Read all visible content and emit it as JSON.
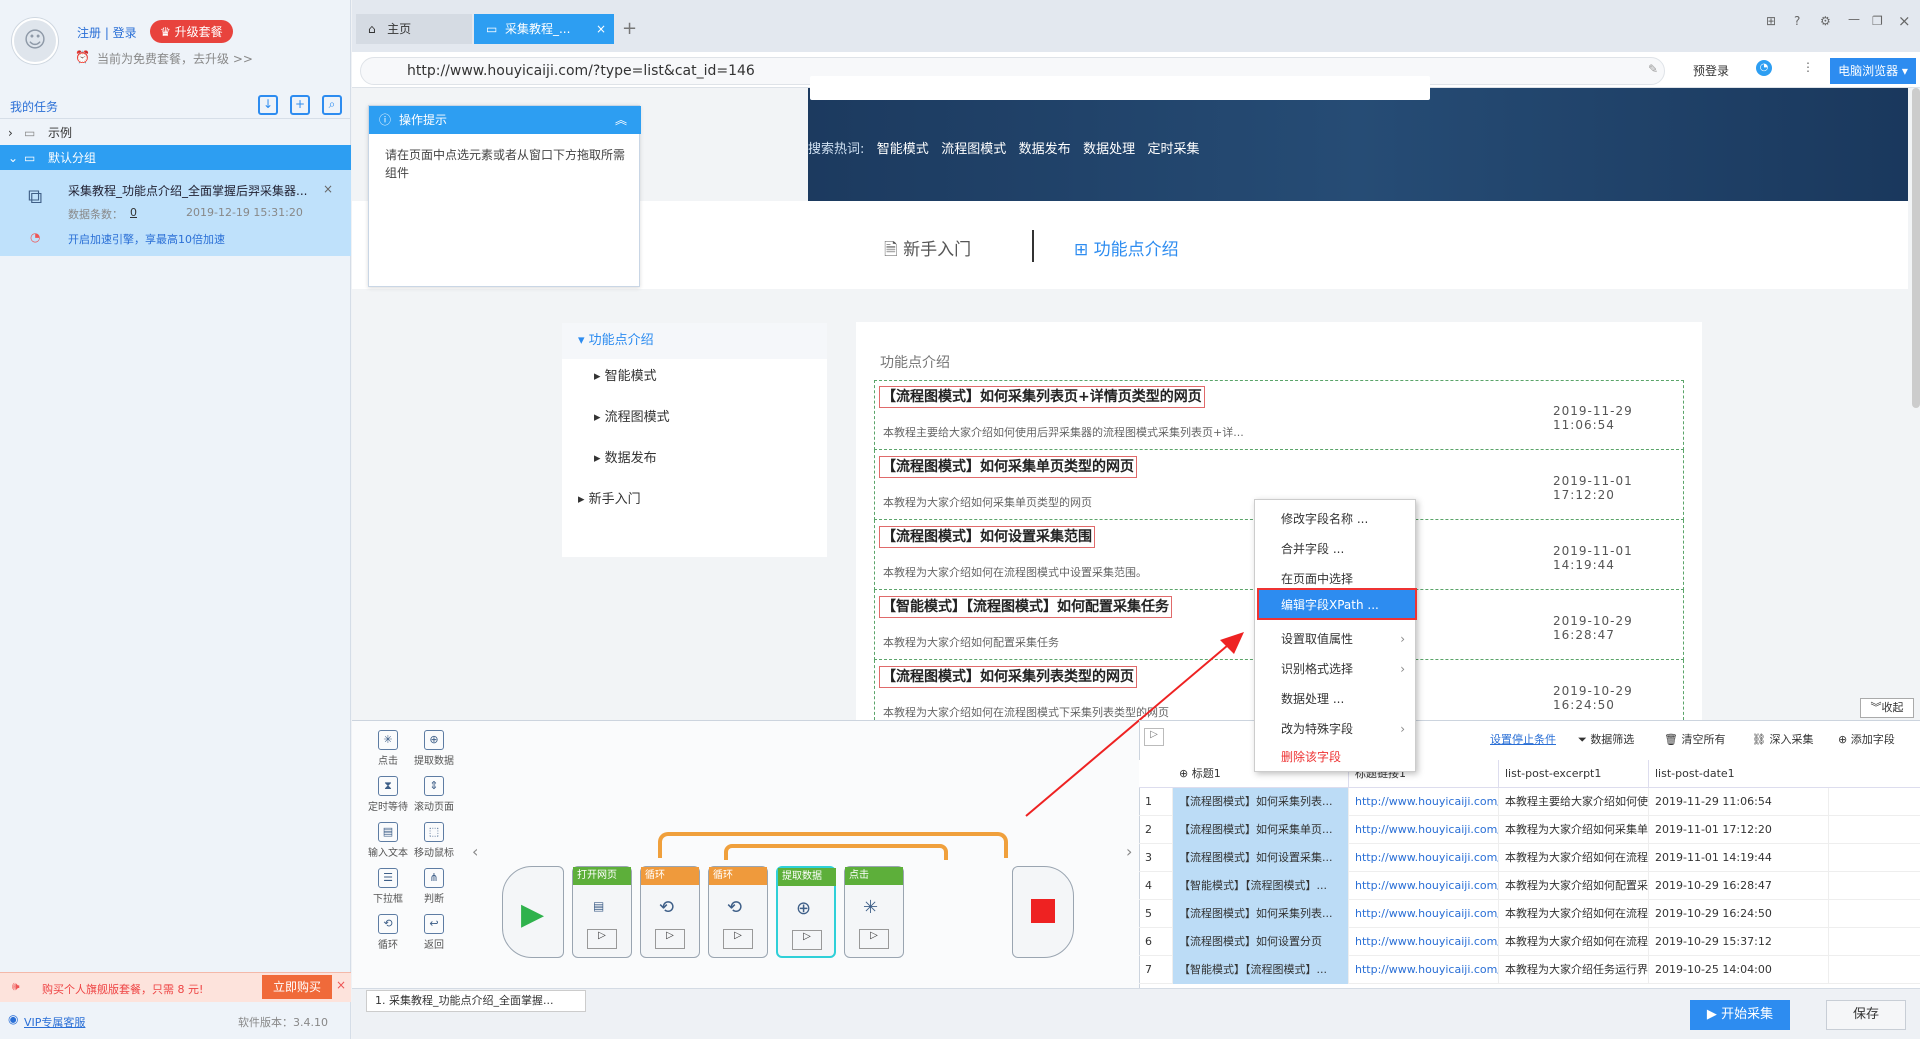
{
  "sidebar": {
    "register_login": "注册 | 登录",
    "upgrade": "升级套餐",
    "plan_text": "当前为免费套餐，去升级 >>",
    "my_tasks": "我的任务",
    "tree": [
      {
        "label": "示例"
      },
      {
        "label": "默认分组"
      }
    ],
    "task": {
      "title": "采集教程_功能点介绍_全面掌握后羿采集器...",
      "count_label": "数据条数：",
      "count": "0",
      "time": "2019-12-19 15:31:20",
      "boost": "开启加速引擎，享最高10倍加速"
    },
    "promo": "购买个人旗舰版套餐，只需 8 元!",
    "buy": "立即购买",
    "vip": "VIP专属客服",
    "version": "软件版本：3.4.10"
  },
  "tabs": {
    "home": "主页",
    "active": "采集教程_..."
  },
  "url": "http://www.houyicaiji.com/?type=list&cat_id=146",
  "toolbar": {
    "prelogin": "预登录",
    "browser": "电脑浏览器"
  },
  "page": {
    "hot_label": "搜索热词:",
    "hot": [
      "智能模式",
      "流程图模式",
      "数据发布",
      "数据处理",
      "定时采集"
    ],
    "tab1": "新手入门",
    "tab2": "功能点介绍",
    "section_title": "功能点介绍",
    "nav": [
      "功能点介绍",
      "智能模式",
      "流程图模式",
      "数据发布",
      "新手入门"
    ],
    "articles": [
      {
        "title": "【流程图模式】如何采集列表页+详情页类型的网页",
        "desc": "本教程主要给大家介绍如何使用后羿采集器的流程图模式采集列表页+详...",
        "date": "2019-11-29 11:06:54"
      },
      {
        "title": "【流程图模式】如何采集单页类型的网页",
        "desc": "本教程为大家介绍如何采集单页类型的网页",
        "date": "2019-11-01 17:12:20"
      },
      {
        "title": "【流程图模式】如何设置采集范围",
        "desc": "本教程为大家介绍如何在流程图模式中设置采集范围。",
        "date": "2019-11-01 14:19:44"
      },
      {
        "title": "【智能模式】【流程图模式】如何配置采集任务",
        "desc": "本教程为大家介绍如何配置采集任务",
        "date": "2019-10-29 16:28:47"
      },
      {
        "title": "【流程图模式】如何采集列表类型的网页",
        "desc": "本教程为大家介绍如何在流程图模式下采集列表类型的网页",
        "date": "2019-10-29 16:24:50"
      }
    ],
    "collapse": "收起"
  },
  "tips": {
    "title": "操作提示",
    "body": "请在页面中点选元素或者从窗口下方拖取所需组件"
  },
  "context_menu": [
    "修改字段名称 ...",
    "合并字段 ...",
    "在页面中选择",
    "编辑字段XPath ...",
    "设置取值属性",
    "识别格式选择",
    "数据处理 ...",
    "改为特殊字段",
    "删除该字段"
  ],
  "tools": [
    "点击",
    "提取数据",
    "定时等待",
    "滚动页面",
    "输入文本",
    "移动鼠标",
    "下拉框",
    "判断",
    "循环",
    "返回"
  ],
  "flow_nodes": [
    "打开网页",
    "循环",
    "循环",
    "提取数据",
    "点击"
  ],
  "data_toolbar": {
    "stop": "设置停止条件",
    "filter": "数据筛选",
    "clear": "清空所有",
    "deep": "深入采集",
    "add": "添加字段"
  },
  "columns": [
    "标题1",
    "标题链接1",
    "list-post-excerpt1",
    "list-post-date1"
  ],
  "rows": [
    [
      "1",
      "【流程图模式】如何采集列表...",
      "http://www.houyicaiji.com/?typ...",
      "本教程主要给大家介绍如何使...",
      "2019-11-29 11:06:54"
    ],
    [
      "2",
      "【流程图模式】如何采集单页...",
      "http://www.houyicaiji.com/?typ...",
      "本教程为大家介绍如何采集单...",
      "2019-11-01 17:12:20"
    ],
    [
      "3",
      "【流程图模式】如何设置采集...",
      "http://www.houyicaiji.com/?typ...",
      "本教程为大家介绍如何在流程...",
      "2019-11-01 14:19:44"
    ],
    [
      "4",
      "【智能模式】【流程图模式】...",
      "http://www.houyicaiji.com/?typ...",
      "本教程为大家介绍如何配置采...",
      "2019-10-29 16:28:47"
    ],
    [
      "5",
      "【流程图模式】如何采集列表...",
      "http://www.houyicaiji.com/?typ...",
      "本教程为大家介绍如何在流程...",
      "2019-10-29 16:24:50"
    ],
    [
      "6",
      "【流程图模式】如何设置分页",
      "http://www.houyicaiji.com/?typ...",
      "本教程为大家介绍如何在流程...",
      "2019-10-29 15:37:12"
    ],
    [
      "7",
      "【智能模式】【流程图模式】...",
      "http://www.houyicaiji.com/?typ...",
      "本教程为大家介绍任务运行界面",
      "2019-10-25 14:04:00"
    ]
  ],
  "bottom": {
    "task_tab": "1. 采集教程_功能点介绍_全面掌握...",
    "start": "开始采集",
    "save": "保存"
  }
}
